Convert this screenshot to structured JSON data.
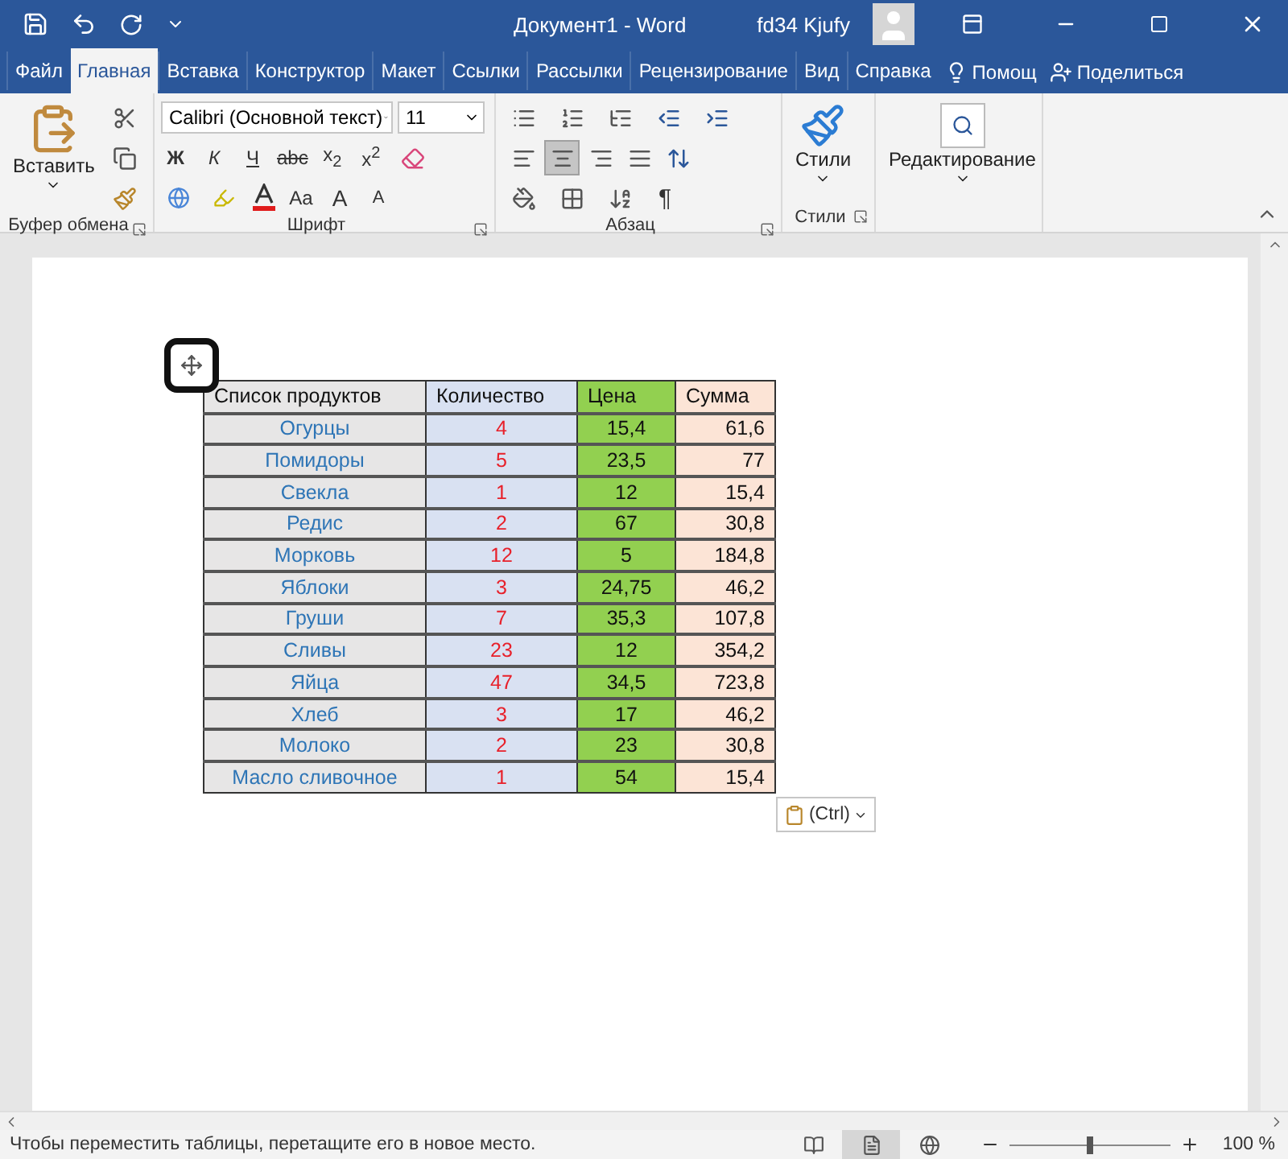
{
  "title_bar": {
    "title": "Документ1  -  Word",
    "user": "fd34 Kjufy"
  },
  "tabs": [
    {
      "label": "Файл",
      "selected": false
    },
    {
      "label": "Главная",
      "selected": true
    },
    {
      "label": "Вставка",
      "selected": false
    },
    {
      "label": "Конструктор",
      "selected": false
    },
    {
      "label": "Макет",
      "selected": false
    },
    {
      "label": "Ссылки",
      "selected": false
    },
    {
      "label": "Рассылки",
      "selected": false
    },
    {
      "label": "Рецензирование",
      "selected": false
    },
    {
      "label": "Вид",
      "selected": false
    },
    {
      "label": "Справка",
      "selected": false
    }
  ],
  "tell_me": "Помощ",
  "share": "Поделиться",
  "ribbon": {
    "clipboard": {
      "paste": "Вставить",
      "label": "Буфер обмена"
    },
    "font": {
      "name": "Calibri (Основной текст)",
      "size": "11",
      "format_buttons": [
        {
          "kind": "bold",
          "label": "Ж"
        },
        {
          "kind": "italic",
          "label": "К"
        },
        {
          "kind": "underline",
          "label": "Ч"
        },
        {
          "kind": "strike",
          "label": "abc"
        },
        {
          "kind": "sub",
          "label": "x$_{2}$"
        },
        {
          "kind": "sup",
          "label": "x$^{2}$"
        }
      ],
      "case_button": "Aa",
      "grow_button": "A",
      "shrink_button": "A",
      "label": "Шрифт"
    },
    "paragraph": {
      "align": [
        {
          "kind": "left",
          "selected": false
        },
        {
          "kind": "center",
          "selected": true
        },
        {
          "kind": "right",
          "selected": false
        },
        {
          "kind": "justify",
          "selected": false
        }
      ],
      "marks_button": "¶",
      "label": "Абзац"
    },
    "styles": {
      "button": "Стили",
      "label": "Стили"
    },
    "editing": {
      "button": "Редактирование"
    }
  },
  "table": {
    "columns": [
      {
        "kind": "name",
        "label": "Список продуктов",
        "color": "#e7e6e6"
      },
      {
        "kind": "quantity",
        "label": "Количество",
        "color": "#d9e1f2"
      },
      {
        "kind": "price",
        "label": "Цена",
        "color": "#92d050"
      },
      {
        "kind": "sum",
        "label": "Сумма",
        "color": "#fce4d6"
      }
    ],
    "rows": [
      [
        "Огурцы",
        "4",
        "15,4",
        "61,6"
      ],
      [
        "Помидоры",
        "5",
        "23,5",
        "77"
      ],
      [
        "Свекла",
        "1",
        "12",
        "15,4"
      ],
      [
        "Редис",
        "2",
        "67",
        "30,8"
      ],
      [
        "Морковь",
        "12",
        "5",
        "184,8"
      ],
      [
        "Яблоки",
        "3",
        "24,75",
        "46,2"
      ],
      [
        "Груши",
        "7",
        "35,3",
        "107,8"
      ],
      [
        "Сливы",
        "23",
        "12",
        "354,2"
      ],
      [
        "Яйца",
        "47",
        "34,5",
        "723,8"
      ],
      [
        "Хлеб",
        "3",
        "17",
        "46,2"
      ],
      [
        "Молоко",
        "2",
        "23",
        "30,8"
      ],
      [
        "Масло сливочное",
        "1",
        "54",
        "15,4"
      ]
    ]
  },
  "paste_options": "(Ctrl)",
  "status_bar": {
    "message": "Чтобы переместить таблицы, перетащите его в новое место.",
    "views": [
      {
        "kind": "read",
        "selected": false
      },
      {
        "kind": "print",
        "selected": true
      },
      {
        "kind": "web",
        "selected": false
      }
    ],
    "zoom": {
      "level": 0.5,
      "reading": "100 %"
    }
  }
}
